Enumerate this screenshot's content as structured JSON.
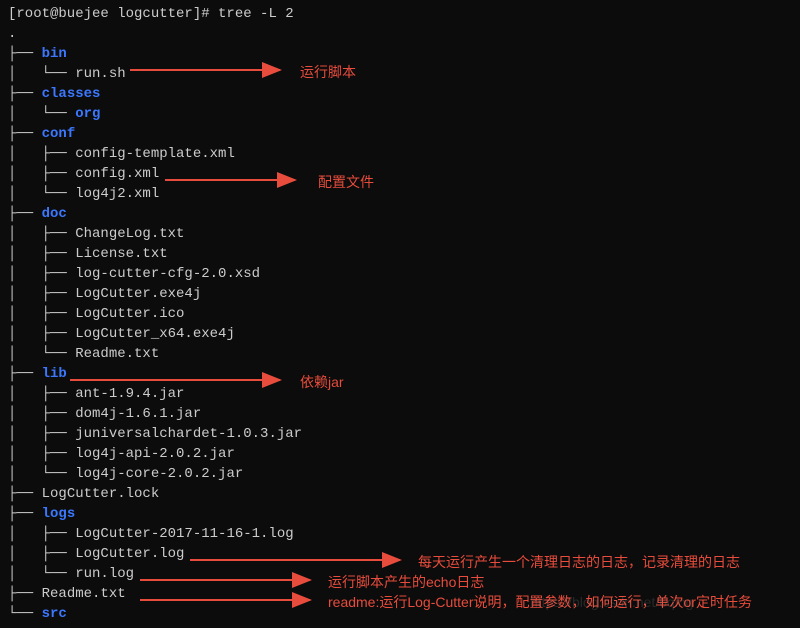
{
  "prompt": "[root@buejee logcutter]# tree -L 2",
  "dot": ".",
  "lines": [
    {
      "prefix": "├── ",
      "name": "bin",
      "dir": true
    },
    {
      "prefix": "│   └── ",
      "name": "run.sh",
      "dir": false
    },
    {
      "prefix": "├── ",
      "name": "classes",
      "dir": true
    },
    {
      "prefix": "│   └── ",
      "name": "org",
      "dir": true
    },
    {
      "prefix": "├── ",
      "name": "conf",
      "dir": true
    },
    {
      "prefix": "│   ├── ",
      "name": "config-template.xml",
      "dir": false
    },
    {
      "prefix": "│   ├── ",
      "name": "config.xml",
      "dir": false
    },
    {
      "prefix": "│   └── ",
      "name": "log4j2.xml",
      "dir": false
    },
    {
      "prefix": "├── ",
      "name": "doc",
      "dir": true
    },
    {
      "prefix": "│   ├── ",
      "name": "ChangeLog.txt",
      "dir": false
    },
    {
      "prefix": "│   ├── ",
      "name": "License.txt",
      "dir": false
    },
    {
      "prefix": "│   ├── ",
      "name": "log-cutter-cfg-2.0.xsd",
      "dir": false
    },
    {
      "prefix": "│   ├── ",
      "name": "LogCutter.exe4j",
      "dir": false
    },
    {
      "prefix": "│   ├── ",
      "name": "LogCutter.ico",
      "dir": false
    },
    {
      "prefix": "│   ├── ",
      "name": "LogCutter_x64.exe4j",
      "dir": false
    },
    {
      "prefix": "│   └── ",
      "name": "Readme.txt",
      "dir": false
    },
    {
      "prefix": "├── ",
      "name": "lib",
      "dir": true
    },
    {
      "prefix": "│   ├── ",
      "name": "ant-1.9.4.jar",
      "dir": false
    },
    {
      "prefix": "│   ├── ",
      "name": "dom4j-1.6.1.jar",
      "dir": false
    },
    {
      "prefix": "│   ├── ",
      "name": "juniversalchardet-1.0.3.jar",
      "dir": false
    },
    {
      "prefix": "│   ├── ",
      "name": "log4j-api-2.0.2.jar",
      "dir": false
    },
    {
      "prefix": "│   └── ",
      "name": "log4j-core-2.0.2.jar",
      "dir": false
    },
    {
      "prefix": "├── ",
      "name": "LogCutter.lock",
      "dir": false
    },
    {
      "prefix": "├── ",
      "name": "logs",
      "dir": true
    },
    {
      "prefix": "│   ├── ",
      "name": "LogCutter-2017-11-16-1.log",
      "dir": false
    },
    {
      "prefix": "│   ├── ",
      "name": "LogCutter.log",
      "dir": false
    },
    {
      "prefix": "│   └── ",
      "name": "run.log",
      "dir": false
    },
    {
      "prefix": "├── ",
      "name": "Readme.txt",
      "dir": false
    },
    {
      "prefix": "└── ",
      "name": "src",
      "dir": true
    }
  ],
  "annots": {
    "run_script": "运行脚本",
    "config_file": "配置文件",
    "dep_jar": "依赖jar",
    "daily_log": "每天运行产生一个清理日志的日志，记录清理的日志",
    "echo_log": "运行脚本产生的echo日志",
    "readme": "readme:运行Log-Cutter说明，配置参数，如何运行，单次or定时任务"
  },
  "watermark": "https://blog.csdn.net/6qing"
}
